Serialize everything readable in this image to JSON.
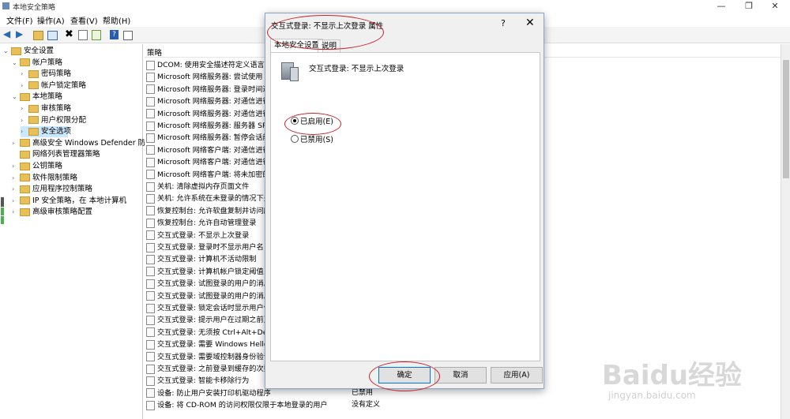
{
  "window": {
    "title": "本地安全策略"
  },
  "menu": [
    "文件(F)",
    "操作(A)",
    "查看(V)",
    "帮助(H)"
  ],
  "tree": [
    {
      "label": "安全设置",
      "level": 0,
      "exp": "v"
    },
    {
      "label": "帐户策略",
      "level": 1,
      "exp": "v"
    },
    {
      "label": "密码策略",
      "level": 2,
      "exp": ">"
    },
    {
      "label": "帐户锁定策略",
      "level": 2,
      "exp": ">"
    },
    {
      "label": "本地策略",
      "level": 1,
      "exp": "v"
    },
    {
      "label": "审核策略",
      "level": 2,
      "exp": ">"
    },
    {
      "label": "用户权限分配",
      "level": 2,
      "exp": ">"
    },
    {
      "label": "安全选项",
      "level": 2,
      "exp": ">",
      "selected": true
    },
    {
      "label": "高级安全 Windows Defender 防火墙",
      "level": 1,
      "exp": ">"
    },
    {
      "label": "网络列表管理器策略",
      "level": 1,
      "exp": ""
    },
    {
      "label": "公钥策略",
      "level": 1,
      "exp": ">"
    },
    {
      "label": "软件限制策略",
      "level": 1,
      "exp": ">"
    },
    {
      "label": "应用程序控制策略",
      "level": 1,
      "exp": ">"
    },
    {
      "label": "IP 安全策略，在 本地计算机",
      "level": 1,
      "exp": ">"
    },
    {
      "label": "高级审核策略配置",
      "level": 1,
      "exp": ">"
    }
  ],
  "list": {
    "header": "策略",
    "rows": [
      {
        "name": "DCOM: 使用安全描述符定义语言(S"
      },
      {
        "name": "Microsoft 网络服务器: 尝试使用 S"
      },
      {
        "name": "Microsoft 网络服务器: 登录时间过"
      },
      {
        "name": "Microsoft 网络服务器: 对通信进行"
      },
      {
        "name": "Microsoft 网络服务器: 对通信进行"
      },
      {
        "name": "Microsoft 网络服务器: 服务器 SPN"
      },
      {
        "name": "Microsoft 网络服务器: 暂停会话前"
      },
      {
        "name": "Microsoft 网络客户端: 对通信进行"
      },
      {
        "name": "Microsoft 网络客户端: 对通信进行"
      },
      {
        "name": "Microsoft 网络客户端: 将未加密的"
      },
      {
        "name": "关机: 清除虚拟内存页面文件"
      },
      {
        "name": "关机: 允许系统在未登录的情况下关"
      },
      {
        "name": "恢复控制台: 允许软盘复制并访问所"
      },
      {
        "name": "恢复控制台: 允许自动管理登录"
      },
      {
        "name": "交互式登录: 不显示上次登录"
      },
      {
        "name": "交互式登录: 登录时不显示用户名"
      },
      {
        "name": "交互式登录: 计算机不活动限制"
      },
      {
        "name": "交互式登录: 计算机帐户锁定阈值"
      },
      {
        "name": "交互式登录: 试图登录的用户的消息"
      },
      {
        "name": "交互式登录: 试图登录的用户的消息"
      },
      {
        "name": "交互式登录: 锁定会话时显示用户信"
      },
      {
        "name": "交互式登录: 提示用户在过期之前更"
      },
      {
        "name": "交互式登录: 无须按 Ctrl+Alt+Del"
      },
      {
        "name": "交互式登录: 需要 Windows Hello"
      },
      {
        "name": "交互式登录: 需要域控制器身份验证"
      },
      {
        "name": "交互式登录: 之前登录到缓存的次数"
      },
      {
        "name": "交互式登录: 智能卡移除行为"
      },
      {
        "name": "设备: 防止用户安装打印机驱动程序",
        "value": "已禁用"
      },
      {
        "name": "设备: 将 CD-ROM 的访问权限仅限于本地登录的用户",
        "value": "没有定义"
      }
    ]
  },
  "dialog": {
    "title": "交互式登录: 不显示上次登录 属性",
    "help": "?",
    "close": "✕",
    "tabs": [
      "本地安全设置",
      "说明"
    ],
    "policy_name": "交互式登录: 不显示上次登录",
    "options": [
      {
        "label": "已启用(E)",
        "checked": true
      },
      {
        "label": "已禁用(S)",
        "checked": false
      }
    ],
    "buttons": {
      "ok": "确定",
      "cancel": "取消",
      "apply": "应用(A)"
    }
  },
  "watermark": {
    "logo": "Baidu经验",
    "url": "jingyan.baidu.com"
  }
}
